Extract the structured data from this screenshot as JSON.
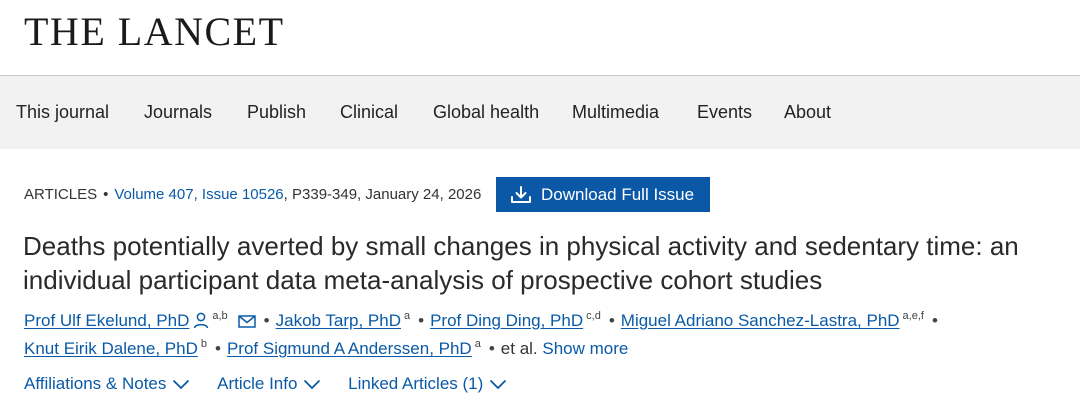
{
  "brand": {
    "logo_text": "THE LANCET"
  },
  "nav": {
    "items": [
      {
        "label": "This journal"
      },
      {
        "label": "Journals"
      },
      {
        "label": "Publish"
      },
      {
        "label": "Clinical"
      },
      {
        "label": "Global health"
      },
      {
        "label": "Multimedia"
      },
      {
        "label": "Events"
      },
      {
        "label": "About"
      }
    ]
  },
  "article": {
    "type": "ARTICLES",
    "issue_link": "Volume 407, Issue 10526",
    "pages_date": "P339-349, January 24, 2026",
    "download_label": "Download Full Issue",
    "title": "Deaths potentially averted by small changes in physical activity and sedentary time: an individual participant data meta-analysis of prospective cohort studies",
    "authors": [
      {
        "name": "Prof Ulf Ekelund, PhD",
        "affil": "a,b"
      },
      {
        "name": "Jakob Tarp, PhD",
        "affil": "a"
      },
      {
        "name": "Prof Ding Ding, PhD",
        "affil": "c,d"
      },
      {
        "name": "Miguel Adriano Sanchez-Lastra, PhD",
        "affil": "a,e,f"
      },
      {
        "name": "Knut Eirik Dalene, PhD",
        "affil": "b"
      },
      {
        "name": "Prof Sigmund A Anderssen, PhD",
        "affil": "a"
      }
    ],
    "et_al": "et al.",
    "show_more": "Show more",
    "tabs": [
      {
        "label": "Affiliations & Notes"
      },
      {
        "label": "Article Info"
      },
      {
        "label": "Linked Articles (1)"
      }
    ]
  },
  "icons": {
    "person": "person-icon",
    "email": "email-icon",
    "download": "download-icon",
    "chevron": "chevron-down-icon"
  },
  "colors": {
    "link": "#0a5aa7",
    "button": "#0a58a6",
    "nav_bg": "#f2f2f2"
  }
}
